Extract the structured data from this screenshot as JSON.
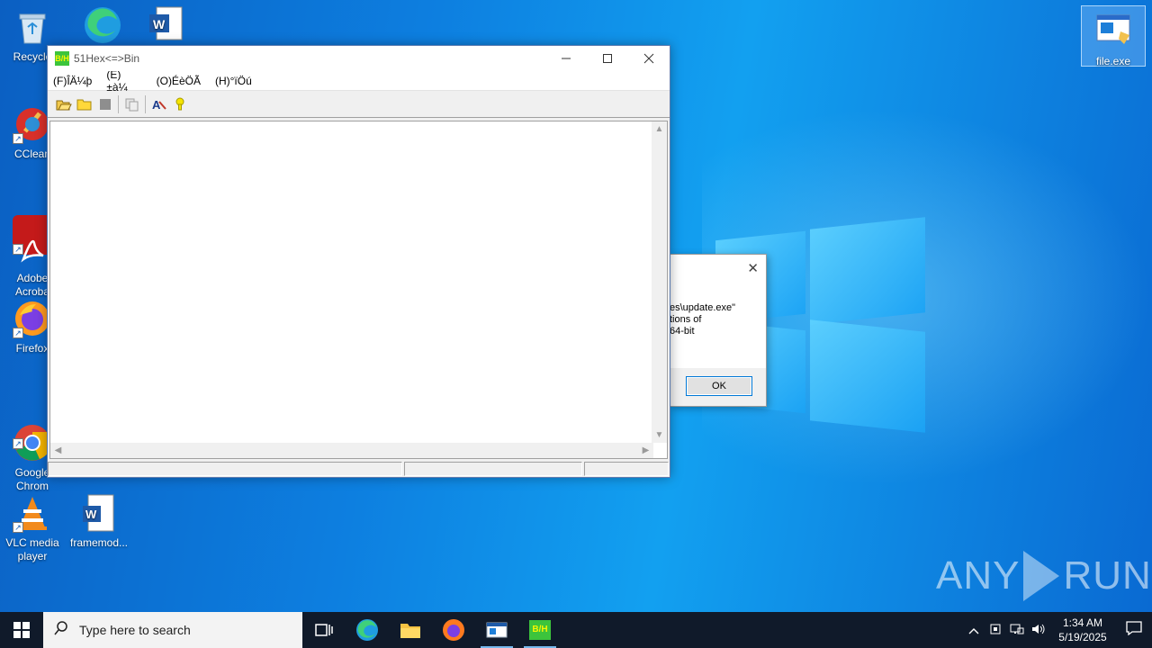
{
  "desktop_icons": [
    {
      "label": "Recycle",
      "icon": "recycle-bin-icon"
    },
    {
      "label": "",
      "icon": "edge-icon"
    },
    {
      "label": "",
      "icon": "word-icon"
    },
    {
      "label": "CClean",
      "icon": "ccleaner-icon"
    },
    {
      "label": "Adobe\nAcroba",
      "icon": "acrobat-icon"
    },
    {
      "label": "Firefox",
      "icon": "firefox-icon"
    },
    {
      "label": "Google\nChrom",
      "icon": "chrome-icon"
    },
    {
      "label": "VLC media player",
      "icon": "vlc-icon"
    },
    {
      "label": "framemod...",
      "icon": "word-doc-icon"
    },
    {
      "label": "file.exe",
      "icon": "file-exe-icon"
    }
  ],
  "app_window": {
    "title": "51Hex<=>Bin",
    "icon_text": "B/H",
    "menu": [
      "(F)ÎÄ¼þ",
      "(E)±à¼­",
      "(O)ÉèÖÃ",
      "(H)°ïÖú"
    ],
    "toolbar": [
      "open-icon",
      "folder-icon",
      "stop-icon",
      "copy-icon",
      "about-icon",
      "help-icon"
    ]
  },
  "message_box": {
    "lines": [
      "es\\update.exe\"",
      "tions of",
      "64-bit"
    ],
    "ok_label": "OK"
  },
  "watermark": {
    "left": "ANY",
    "right": "RUN"
  },
  "taskbar": {
    "search_placeholder": "Type here to search",
    "time": "1:34 AM",
    "date": "5/19/2025"
  }
}
